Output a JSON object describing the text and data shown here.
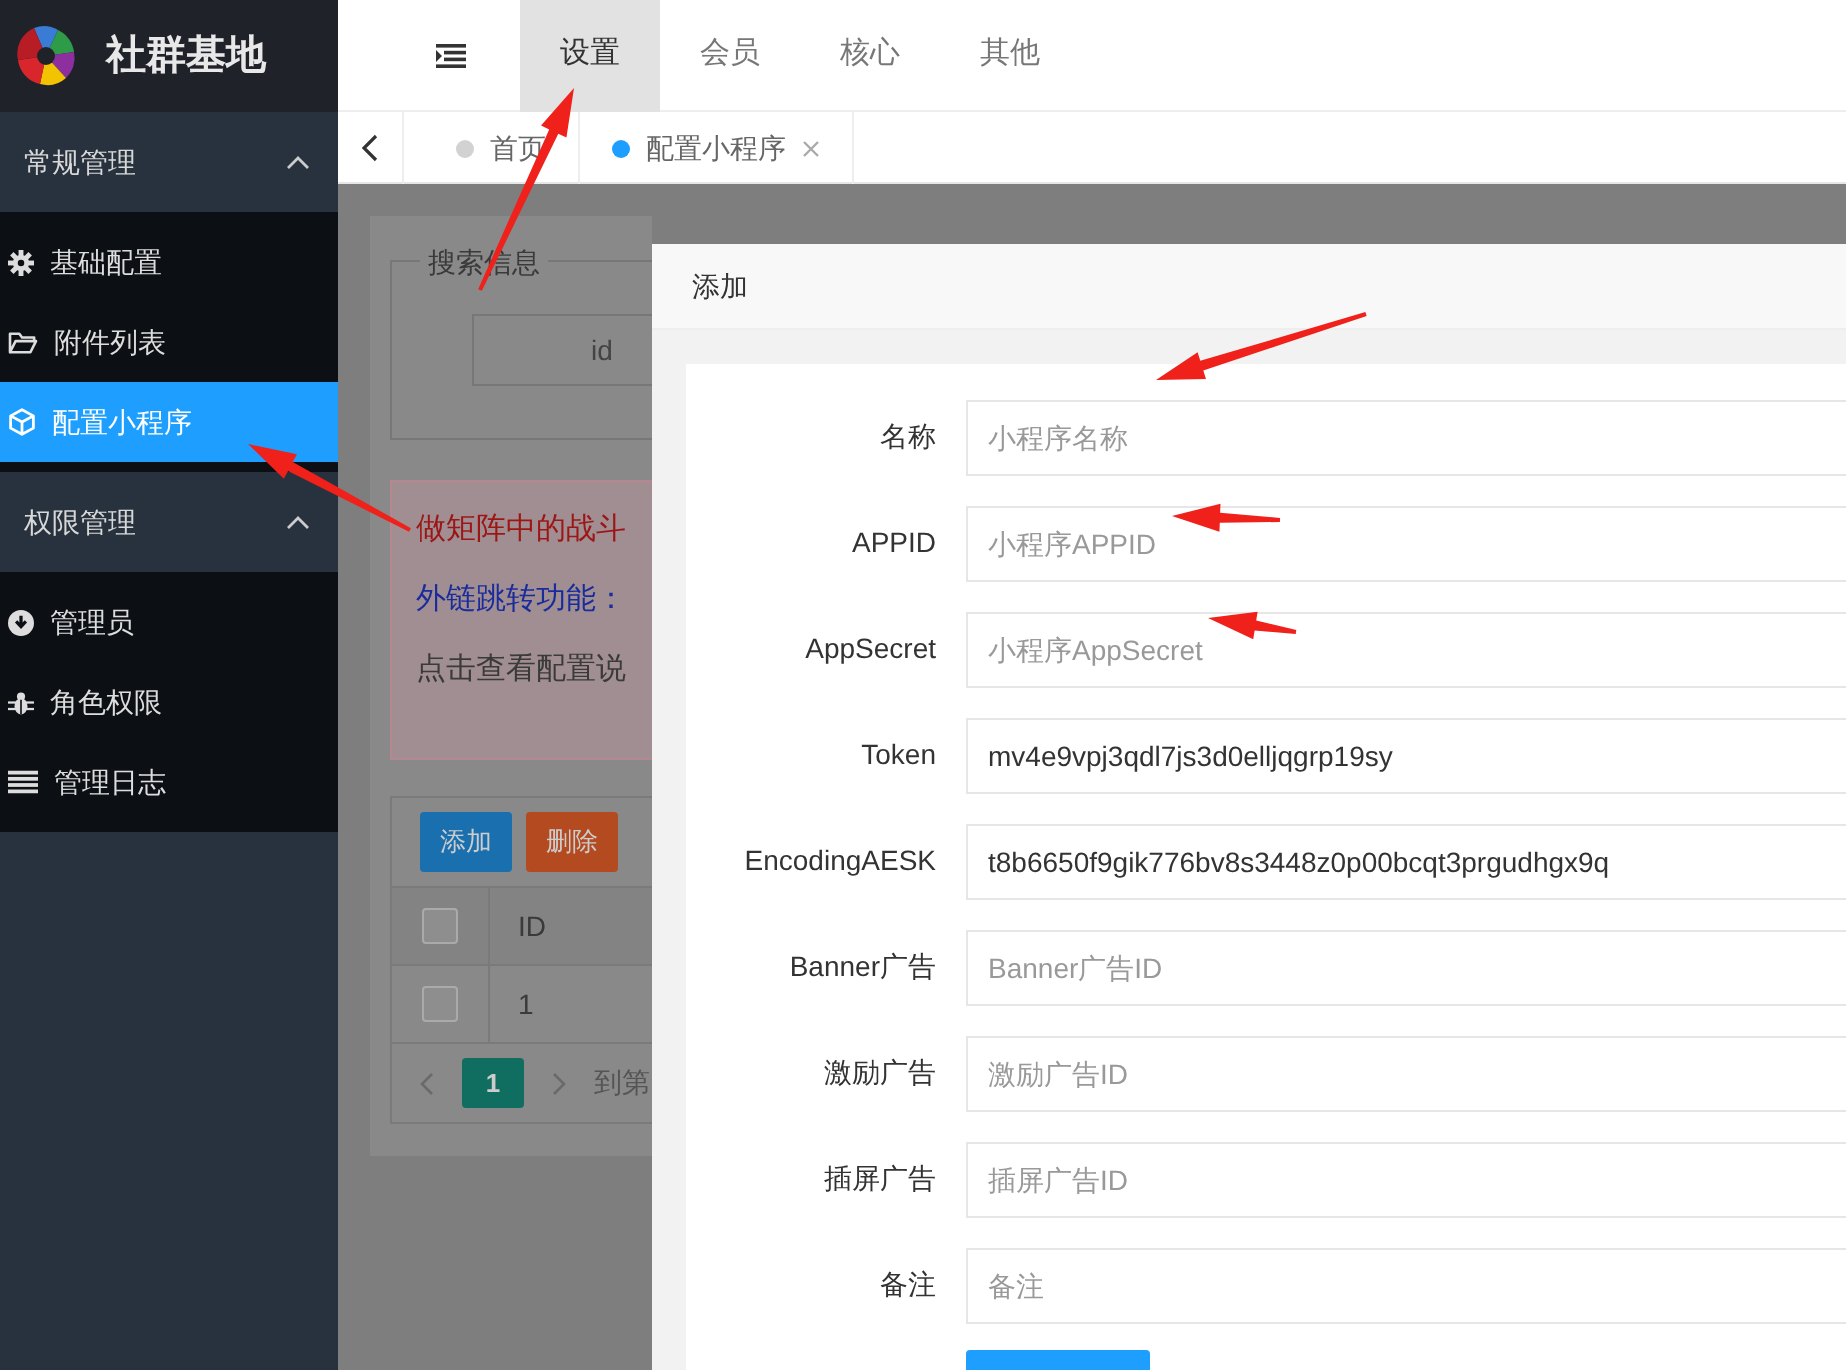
{
  "logo": {
    "title": "社群基地"
  },
  "top_nav": [
    {
      "label": "设置",
      "selected": true
    },
    {
      "label": "会员",
      "selected": false
    },
    {
      "label": "核心",
      "selected": false
    },
    {
      "label": "其他",
      "selected": false
    }
  ],
  "tabs": [
    {
      "label": "首页",
      "selected": false
    },
    {
      "label": "配置小程序",
      "selected": true
    }
  ],
  "sidebar": {
    "groups": [
      {
        "label": "常规管理",
        "expanded": true,
        "items": [
          {
            "label": "基础配置",
            "selected": false
          },
          {
            "label": "附件列表",
            "selected": false
          },
          {
            "label": "配置小程序",
            "selected": true
          }
        ]
      },
      {
        "label": "权限管理",
        "expanded": true,
        "items": [
          {
            "label": "管理员",
            "selected": false
          },
          {
            "label": "角色权限",
            "selected": false
          },
          {
            "label": "管理日志",
            "selected": false
          }
        ]
      }
    ]
  },
  "background_page": {
    "search_legend": "搜索信息",
    "search_placeholder": "id",
    "notice_lines": [
      {
        "kind": "warning",
        "text": "做矩阵中的战斗"
      },
      {
        "kind": "link",
        "text": "外链跳转功能："
      },
      {
        "kind": "plain",
        "text": "点击查看配置说"
      }
    ],
    "buttons": [
      {
        "kind": "primary",
        "label": "添加"
      },
      {
        "kind": "danger",
        "label": "删除"
      }
    ],
    "table": {
      "header_checked": false,
      "columns": [
        "ID"
      ],
      "rows": [
        {
          "checked": false,
          "id": "1"
        }
      ]
    },
    "pagination": {
      "current": "1",
      "goto_label": "到第"
    }
  },
  "modal": {
    "title": "添加",
    "fields": [
      {
        "label": "名称",
        "placeholder": "小程序名称"
      },
      {
        "label": "APPID",
        "placeholder": "小程序APPID"
      },
      {
        "label": "AppSecret",
        "placeholder": "小程序AppSecret"
      },
      {
        "label": "Token",
        "value": "mv4e9vpj3qdl7js3d0elljqgrp19sy"
      },
      {
        "label": "EncodingAESK",
        "value": "t8b6650f9gik776bv8s3448z0p00bcqt3prgudhgx9q"
      },
      {
        "label": "Banner广告",
        "placeholder": "Banner广告ID"
      },
      {
        "label": "激励广告",
        "placeholder": "激励广告ID"
      },
      {
        "label": "插屏广告",
        "placeholder": "插屏广告ID"
      },
      {
        "label": "备注",
        "placeholder": "备注"
      }
    ]
  }
}
